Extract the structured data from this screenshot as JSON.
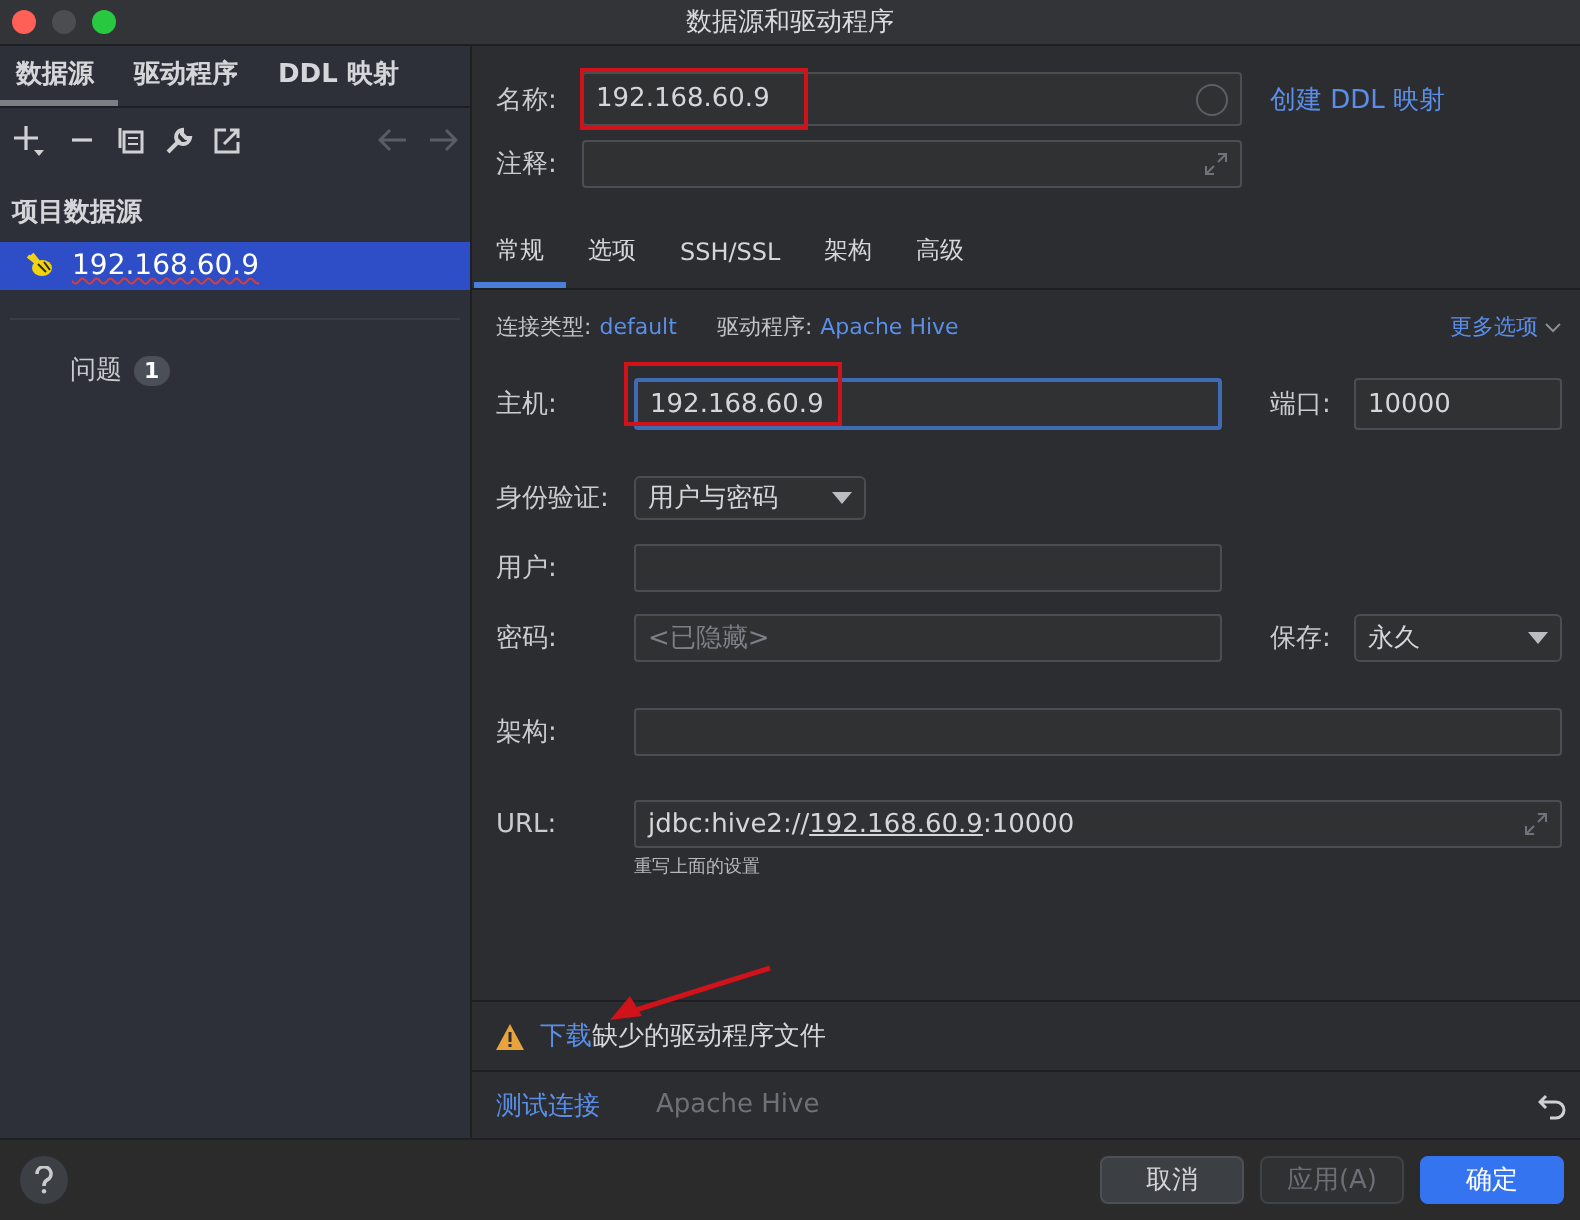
{
  "window": {
    "title": "数据源和驱动程序"
  },
  "sidebar": {
    "tabs": [
      {
        "label": "数据源",
        "selected": true
      },
      {
        "label": "驱动程序",
        "selected": false
      },
      {
        "label": "DDL 映射",
        "selected": false
      }
    ],
    "section_title": "项目数据源",
    "items": [
      {
        "label": "192.168.60.9",
        "selected": true
      }
    ],
    "problems": {
      "label": "问题",
      "count": "1"
    }
  },
  "form": {
    "name": {
      "label": "名称:",
      "value": "192.168.60.9"
    },
    "ddl_link": "创建 DDL 映射",
    "comment": {
      "label": "注释:"
    },
    "tabs": [
      {
        "label": "常规",
        "selected": true
      },
      {
        "label": "选项",
        "selected": false
      },
      {
        "label": "SSH/SSL",
        "selected": false
      },
      {
        "label": "架构",
        "selected": false
      },
      {
        "label": "高级",
        "selected": false
      }
    ],
    "connection_type_label": "连接类型:",
    "connection_type": "default",
    "driver_label": "驱动程序:",
    "driver": "Apache Hive",
    "more_options": "更多选项",
    "host": {
      "label": "主机:",
      "value": "192.168.60.9",
      "focused": true
    },
    "port": {
      "label": "端口:",
      "value": "10000"
    },
    "auth": {
      "label": "身份验证:",
      "value": "用户与密码"
    },
    "user": {
      "label": "用户:"
    },
    "password": {
      "label": "密码:",
      "placeholder": "<已隐藏>"
    },
    "save": {
      "label": "保存:",
      "value": "永久"
    },
    "schema": {
      "label": "架构:"
    },
    "url": {
      "label": "URL:",
      "prefix": "jdbc:hive2://",
      "host": "192.168.60.9",
      "suffix": ":10000",
      "hint": "重写上面的设置"
    },
    "warning": {
      "link": "下载",
      "text": "缺少的驱动程序文件"
    },
    "test_link": "测试连接",
    "driver_name": "Apache Hive"
  },
  "buttons": [
    {
      "label": "取消",
      "kind": "default",
      "disabled": false
    },
    {
      "label": "应用(A)",
      "kind": "default",
      "disabled": true
    },
    {
      "label": "确定",
      "kind": "primary",
      "disabled": false
    }
  ]
}
